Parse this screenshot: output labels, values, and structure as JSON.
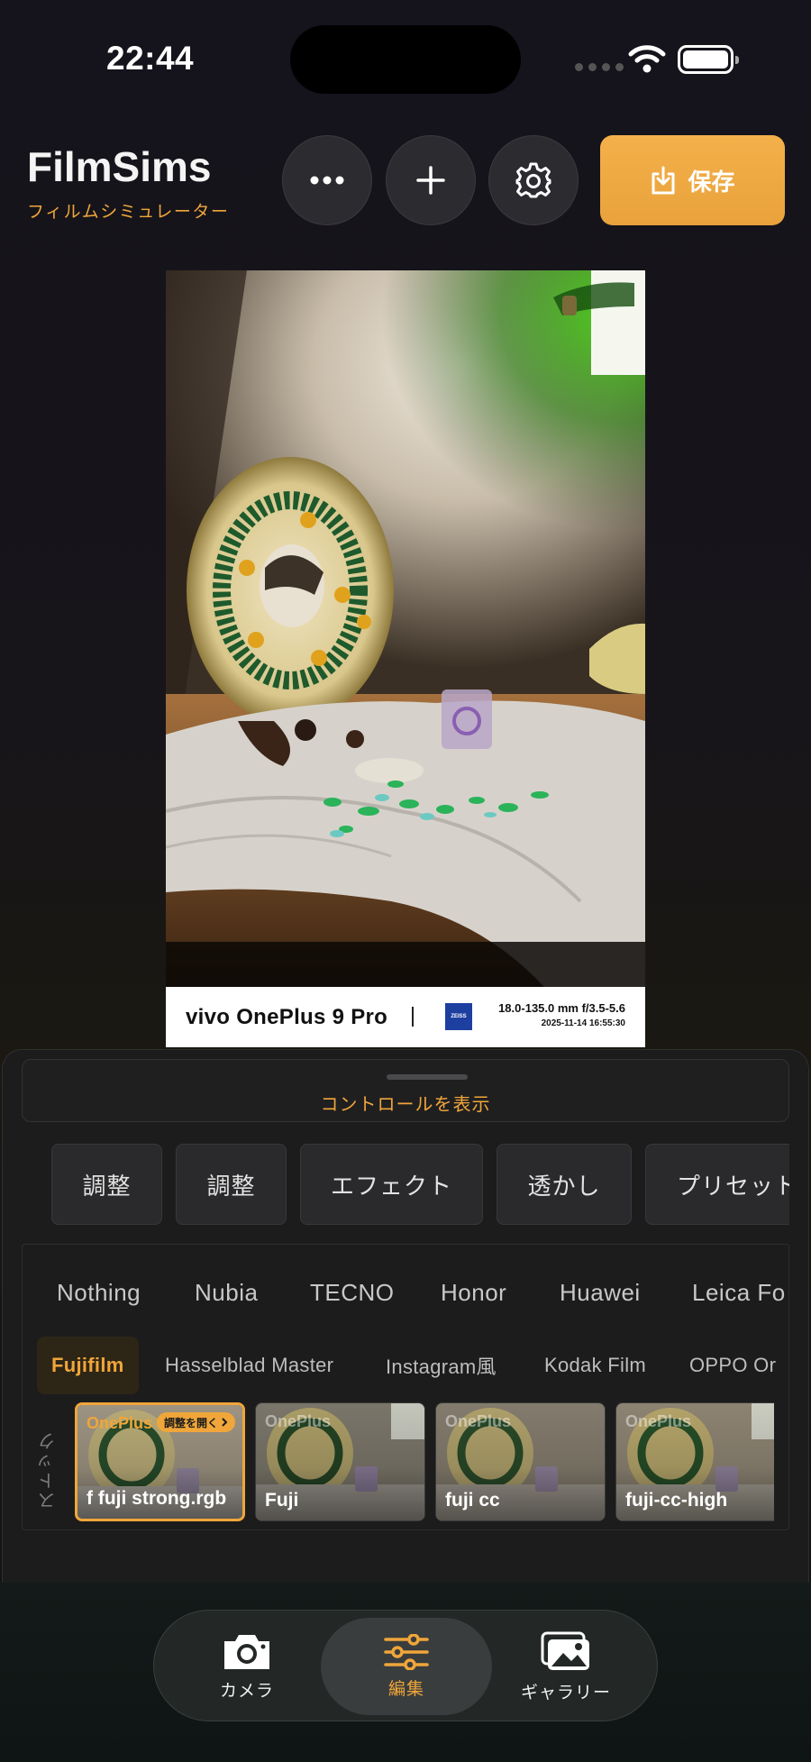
{
  "status_bar": {
    "time": "22:44"
  },
  "header": {
    "title": "FilmSims",
    "subtitle": "フィルムシミュレーター",
    "save_label": "保存"
  },
  "photo": {
    "watermark": {
      "brand": "vivo OnePlus 9 Pro",
      "logo_text": "ZEISS",
      "spec": "18.0-135.0 mm f/3.5-5.6",
      "date": "2025-11-14 16:55:30"
    }
  },
  "controls": {
    "toggle_label": "コントロールを表示"
  },
  "tabs": [
    "調整",
    "調整",
    "エフェクト",
    "透かし",
    "プリセット"
  ],
  "brands": [
    "Nothing",
    "Nubia",
    "TECNO",
    "Honor",
    "Huawei",
    "Leica Fo"
  ],
  "categories": [
    "Fujifilm",
    "Hasselblad Master",
    "Instagram風",
    "Kodak Film",
    "OPPO Or"
  ],
  "stock_label": "ストック",
  "presets": [
    {
      "brand": "OnePlus",
      "name": "f fuji strong.rgb",
      "badge": "調整を開く"
    },
    {
      "brand": "OnePlus",
      "name": "Fuji"
    },
    {
      "brand": "OnePlus",
      "name": "fuji cc"
    },
    {
      "brand": "OnePlus",
      "name": "fuji-cc-high"
    }
  ],
  "nav": [
    {
      "label": "カメラ",
      "icon": "camera-icon"
    },
    {
      "label": "編集",
      "icon": "sliders-icon"
    },
    {
      "label": "ギャラリー",
      "icon": "gallery-icon"
    }
  ],
  "colors": {
    "accent": "#f0a63a",
    "background": "#17151a"
  }
}
